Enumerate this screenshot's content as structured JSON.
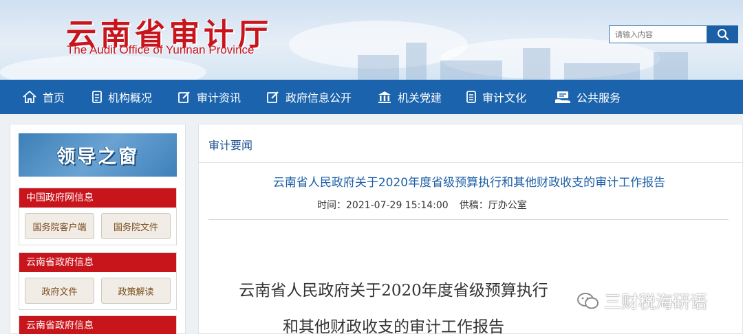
{
  "header": {
    "title": "云南省审计厅",
    "subtitle": "The Audit Office of Yunnan Province"
  },
  "search": {
    "placeholder": "请输入内容",
    "icon": "search-icon"
  },
  "nav": {
    "items": [
      {
        "label": "首页",
        "icon": "home-icon"
      },
      {
        "label": "机构概况",
        "icon": "document-icon"
      },
      {
        "label": "审计资讯",
        "icon": "edit-icon"
      },
      {
        "label": "政府信息公开",
        "icon": "edit-icon"
      },
      {
        "label": "机关党建",
        "icon": "building-icon"
      },
      {
        "label": "审计文化",
        "icon": "list-icon"
      },
      {
        "label": "公共服务",
        "icon": "service-icon"
      }
    ]
  },
  "sidebar": {
    "banner": "领导之窗",
    "panels": [
      {
        "title": "中国政府网信息",
        "buttons": [
          "国务院客户端",
          "国务院文件"
        ]
      },
      {
        "title": "云南省政府信息",
        "buttons": [
          "政府文件",
          "政策解读"
        ]
      },
      {
        "title": "云南省政府信息"
      }
    ]
  },
  "main": {
    "section_title": "审计要闻",
    "article_title": "云南省人民政府关于2020年度省级预算执行和其他财政收支的审计工作报告",
    "time_label": "时间：",
    "time_value": "2021-07-29 15:14:00",
    "source_label": "供稿：",
    "source_value": "厅办公室",
    "doc_title_line1": "云南省人民政府关于2020年度省级预算执行",
    "doc_title_line2": "和其他财政收支的审计工作报告"
  },
  "watermark": {
    "text": "三财税海研语",
    "icon": "wechat-icon"
  },
  "colors": {
    "brand_red": "#c8151d",
    "nav_blue": "#1b64ad",
    "link_blue": "#1b5fa6"
  }
}
